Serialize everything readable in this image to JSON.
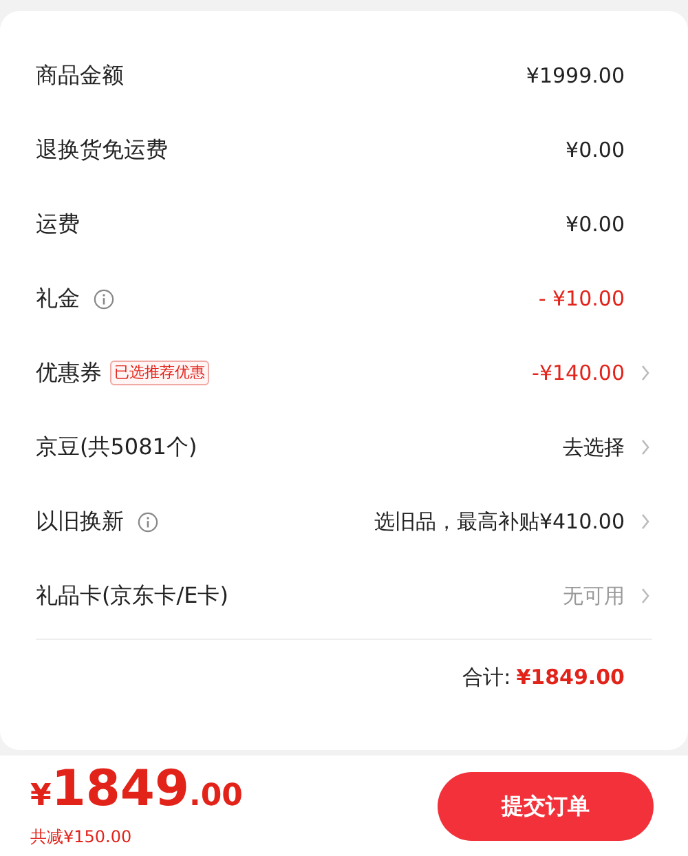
{
  "fee_rows": [
    {
      "label": "商品金额",
      "info": false,
      "value": "¥1999.00",
      "color": "#222222",
      "arrow": false
    },
    {
      "label": "退换货免运费",
      "info": false,
      "value": "¥0.00",
      "color": "#222222",
      "arrow": false
    },
    {
      "label": "运费",
      "info": false,
      "value": "¥0.00",
      "color": "#222222",
      "arrow": false
    },
    {
      "label": "礼金",
      "info": true,
      "value": "- ¥10.00",
      "color": "#e2231a",
      "arrow": false
    },
    {
      "label": "优惠券",
      "info": false,
      "tag": "已选推荐优惠",
      "value": "-¥140.00",
      "color": "#e2231a",
      "arrow": true
    },
    {
      "label": "京豆(共5081个)",
      "info": false,
      "value": "去选择",
      "color": "#222222",
      "arrow": true
    },
    {
      "label": "以旧换新",
      "info": true,
      "value": "选旧品，最高补贴¥410.00",
      "color": "#222222",
      "arrow": true
    },
    {
      "label": "礼品卡(京东卡/E卡)",
      "info": false,
      "value": "无可用",
      "color": "#999999",
      "arrow": true
    }
  ],
  "total": {
    "label": "合计:",
    "amount": "¥1849.00"
  },
  "bottom_bar": {
    "currency": "¥",
    "price_main": "1849",
    "price_decimal": ".00",
    "savings": "共减¥150.00",
    "submit_button": "提交订单"
  }
}
